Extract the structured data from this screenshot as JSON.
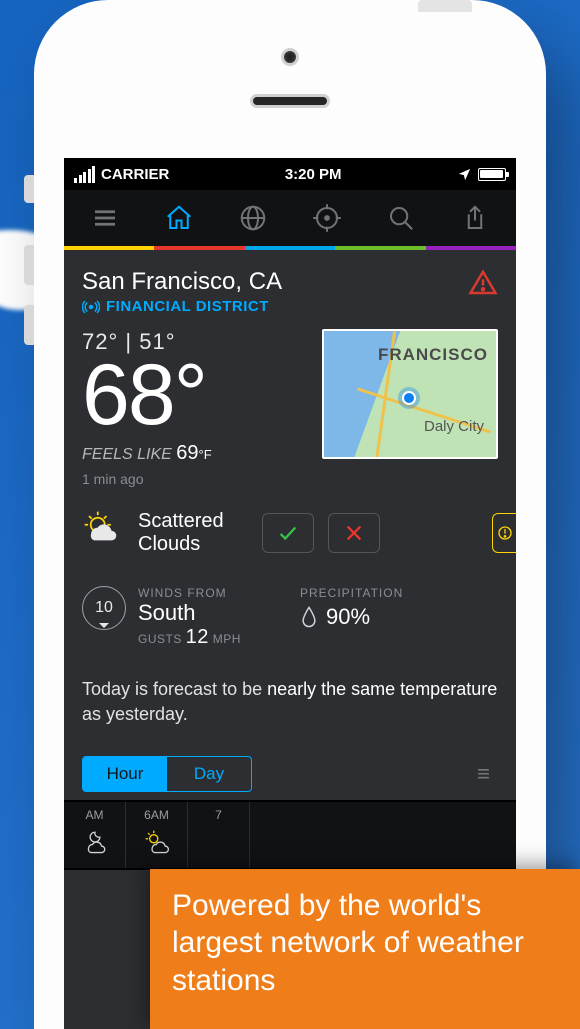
{
  "status": {
    "carrier": "CARRIER",
    "time": "3:20 PM"
  },
  "location": {
    "city": "San Francisco, CA",
    "station": "FINANCIAL DISTRICT"
  },
  "current": {
    "hi": "72°",
    "lo": "51°",
    "hi_lo_sep": "  |  ",
    "temp": "68°",
    "feels_label": "FEELS LIKE ",
    "feels_value": "69",
    "feels_unit": "°F",
    "updated": "1 min ago",
    "condition": "Scattered Clouds"
  },
  "map": {
    "label1": "FRANCISCO",
    "label2": "Daly City"
  },
  "wind": {
    "label": "WINDS FROM",
    "direction": "South",
    "speed": "10",
    "gusts_label": "GUSTS ",
    "gusts_value": "12",
    "gusts_unit": " MPH"
  },
  "precip": {
    "label": "PRECIPITATION",
    "value": "90%"
  },
  "narrative": {
    "pre": "Today is forecast to be ",
    "em": "nearly the same temperature",
    "post": " as yesterday."
  },
  "segmented": {
    "hour": "Hour",
    "day": "Day"
  },
  "hours": [
    {
      "label": "AM",
      "icon": "cloud-moon"
    },
    {
      "label": "6AM",
      "icon": "sun-cloud"
    },
    {
      "label": "7",
      "icon": ""
    }
  ],
  "promo": "Powered by the world's largest network of weather stations"
}
